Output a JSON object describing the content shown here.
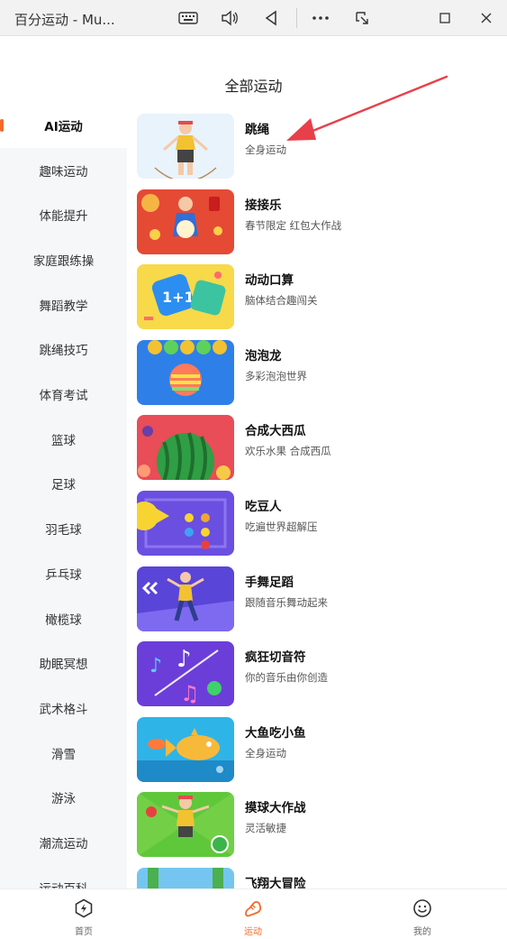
{
  "window": {
    "title": "百分运动 - Mu..."
  },
  "page": {
    "title": "全部运动"
  },
  "colors": {
    "accent": "#f36a2a",
    "arrow": "#e8404a",
    "sidebar_bg": "#f6f7f9"
  },
  "sidebar": {
    "items": [
      {
        "label": "AI运动",
        "active": true
      },
      {
        "label": "趣味运动"
      },
      {
        "label": "体能提升"
      },
      {
        "label": "家庭跟练操"
      },
      {
        "label": "舞蹈教学"
      },
      {
        "label": "跳绳技巧"
      },
      {
        "label": "体育考试"
      },
      {
        "label": "篮球"
      },
      {
        "label": "足球"
      },
      {
        "label": "羽毛球"
      },
      {
        "label": "乒乓球"
      },
      {
        "label": "橄榄球"
      },
      {
        "label": "助眠冥想"
      },
      {
        "label": "武术格斗"
      },
      {
        "label": "滑雪"
      },
      {
        "label": "游泳"
      },
      {
        "label": "潮流运动"
      },
      {
        "label": "运动百科"
      }
    ]
  },
  "games": [
    {
      "title": "跳绳",
      "desc": "全身运动",
      "thumb": "jump-rope"
    },
    {
      "title": "接接乐",
      "desc": "春节限定 红包大作战",
      "thumb": "catch"
    },
    {
      "title": "动动口算",
      "desc": "脑体结合趣闯关",
      "thumb": "math"
    },
    {
      "title": "泡泡龙",
      "desc": "多彩泡泡世界",
      "thumb": "bubble"
    },
    {
      "title": "合成大西瓜",
      "desc": "欢乐水果 合成西瓜",
      "thumb": "watermelon"
    },
    {
      "title": "吃豆人",
      "desc": "吃遍世界超解压",
      "thumb": "pacman"
    },
    {
      "title": "手舞足蹈",
      "desc": "跟随音乐舞动起来",
      "thumb": "dance"
    },
    {
      "title": "疯狂切音符",
      "desc": "你的音乐由你创造",
      "thumb": "notes"
    },
    {
      "title": "大鱼吃小鱼",
      "desc": "全身运动",
      "thumb": "fish"
    },
    {
      "title": "摸球大作战",
      "desc": "灵活敏捷",
      "thumb": "ball"
    },
    {
      "title": "飞翔大冒险",
      "desc": "",
      "thumb": "fly"
    }
  ],
  "bottom_nav": [
    {
      "label": "首页",
      "icon": "home-bolt-icon"
    },
    {
      "label": "运动",
      "icon": "sneaker-icon",
      "active": true
    },
    {
      "label": "我的",
      "icon": "smile-icon"
    }
  ]
}
